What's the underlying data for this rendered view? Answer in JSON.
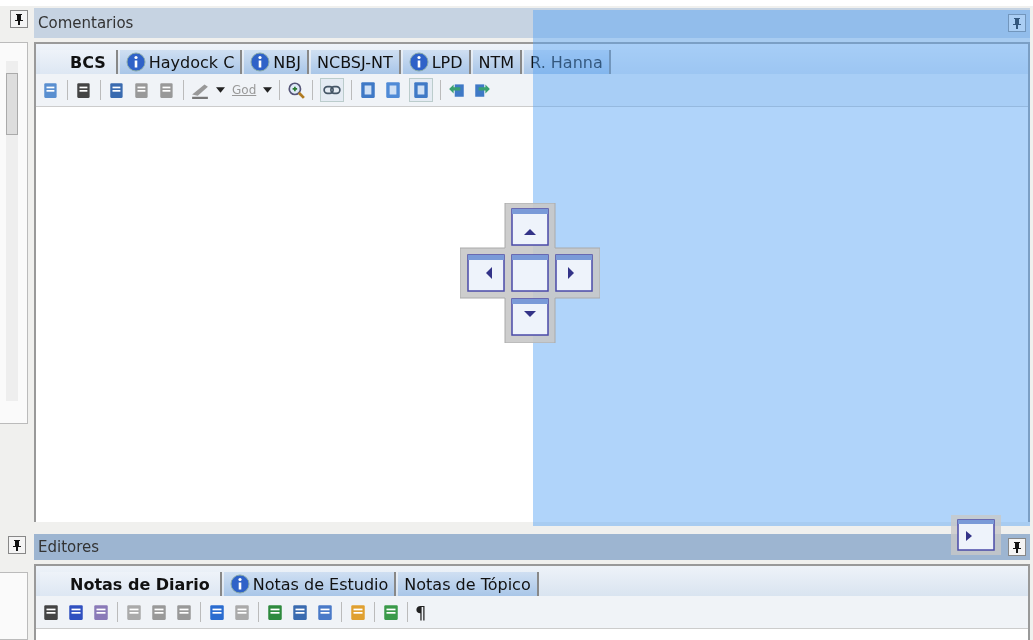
{
  "comentarios": {
    "title": "Comentarios",
    "tabs": [
      {
        "label": "BCS",
        "info": false,
        "selected": true
      },
      {
        "label": "Haydock C",
        "info": true,
        "selected": false
      },
      {
        "label": "NBJ",
        "info": true,
        "selected": false
      },
      {
        "label": "NCBSJ-NT",
        "info": false,
        "selected": false
      },
      {
        "label": "LPD",
        "info": true,
        "selected": false
      },
      {
        "label": "NTM",
        "info": false,
        "selected": false
      },
      {
        "label": "R. Hanna",
        "info": false,
        "selected": false
      }
    ],
    "style_dropdown": "God"
  },
  "editores": {
    "title": "Editores",
    "tabs": [
      {
        "label": "Notas de Diario",
        "info": false,
        "selected": true
      },
      {
        "label": "Notas de Estudio",
        "info": true,
        "selected": false
      },
      {
        "label": "Notas de Tópico",
        "info": false,
        "selected": false
      }
    ],
    "paragraph_mark": "¶"
  }
}
